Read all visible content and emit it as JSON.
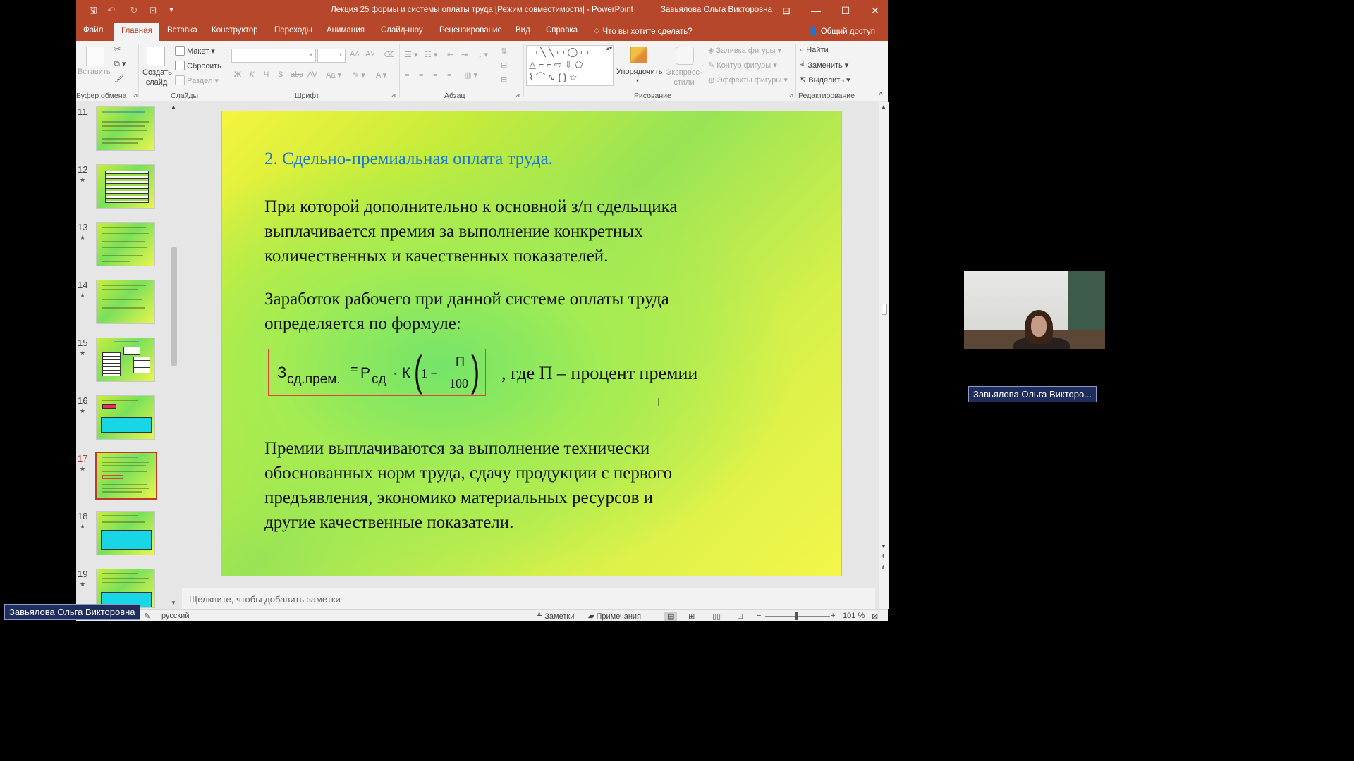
{
  "window": {
    "title": "Лекция 25 формы и системы оплаты труда [Режим совместимости]  -  PowerPoint",
    "user": "Завьялова Ольга Викторовна"
  },
  "tabs": [
    "Файл",
    "Главная",
    "Вставка",
    "Конструктор",
    "Переходы",
    "Анимация",
    "Слайд-шоу",
    "Рецензирование",
    "Вид",
    "Справка"
  ],
  "tell_me": "Что вы хотите сделать?",
  "share": "Общий доступ",
  "ribbon": {
    "clipboard": {
      "paste": "Вставить",
      "label": "Буфер обмена"
    },
    "slides": {
      "new_slide": "Создать слайд",
      "layout": "Макет",
      "reset": "Сбросить",
      "section": "Раздел",
      "label": "Слайды"
    },
    "font": {
      "label": "Шрифт"
    },
    "paragraph": {
      "label": "Абзац"
    },
    "drawing": {
      "arrange": "Упорядочить",
      "quick_styles": "Экспресс-стили",
      "shape_fill": "Заливка фигуры",
      "shape_outline": "Контур фигуры",
      "shape_effects": "Эффекты фигуры",
      "label": "Рисование"
    },
    "editing": {
      "find": "Найти",
      "replace": "Заменить",
      "select": "Выделить",
      "label": "Редактирование"
    }
  },
  "thumbnails": {
    "numbers": [
      "11",
      "12",
      "13",
      "14",
      "15",
      "16",
      "17",
      "18",
      "19"
    ],
    "selected": "17"
  },
  "slide": {
    "title": "2. Сдельно-премиальная оплата труда.",
    "para1": [
      "При которой дополнительно к основной з/п сдельщика",
      "выплачивается премия за выполнение конкретных",
      "количественных и качественных показателей."
    ],
    "para2": [
      "Заработок рабочего при данной системе оплаты труда",
      "определяется по формуле:"
    ],
    "formula": {
      "lhs_main": "З",
      "lhs_sub": "сд.прем.",
      "eq": "=",
      "p_main": "Р",
      "p_sub": "сд",
      "k": "· К",
      "one_plus": "1 +",
      "numerator": "П",
      "denominator": "100"
    },
    "where": ", где П – процент премии",
    "para3": [
      "Премии выплачиваются за выполнение технически",
      "обоснованных норм труда, сдачу продукции с первого",
      "предъявления, экономико материальных ресурсов и",
      "другие качественные показатели."
    ]
  },
  "notes_placeholder": "Щелкните, чтобы добавить заметки",
  "status": {
    "language": "русский",
    "notes": "Заметки",
    "comments": "Примечания",
    "zoom": "101 %"
  },
  "video": {
    "participant_name_right": "Завьялова Ольга Викторо...",
    "participant_name_bottom": "Завьялова Ольга Викторовна"
  }
}
